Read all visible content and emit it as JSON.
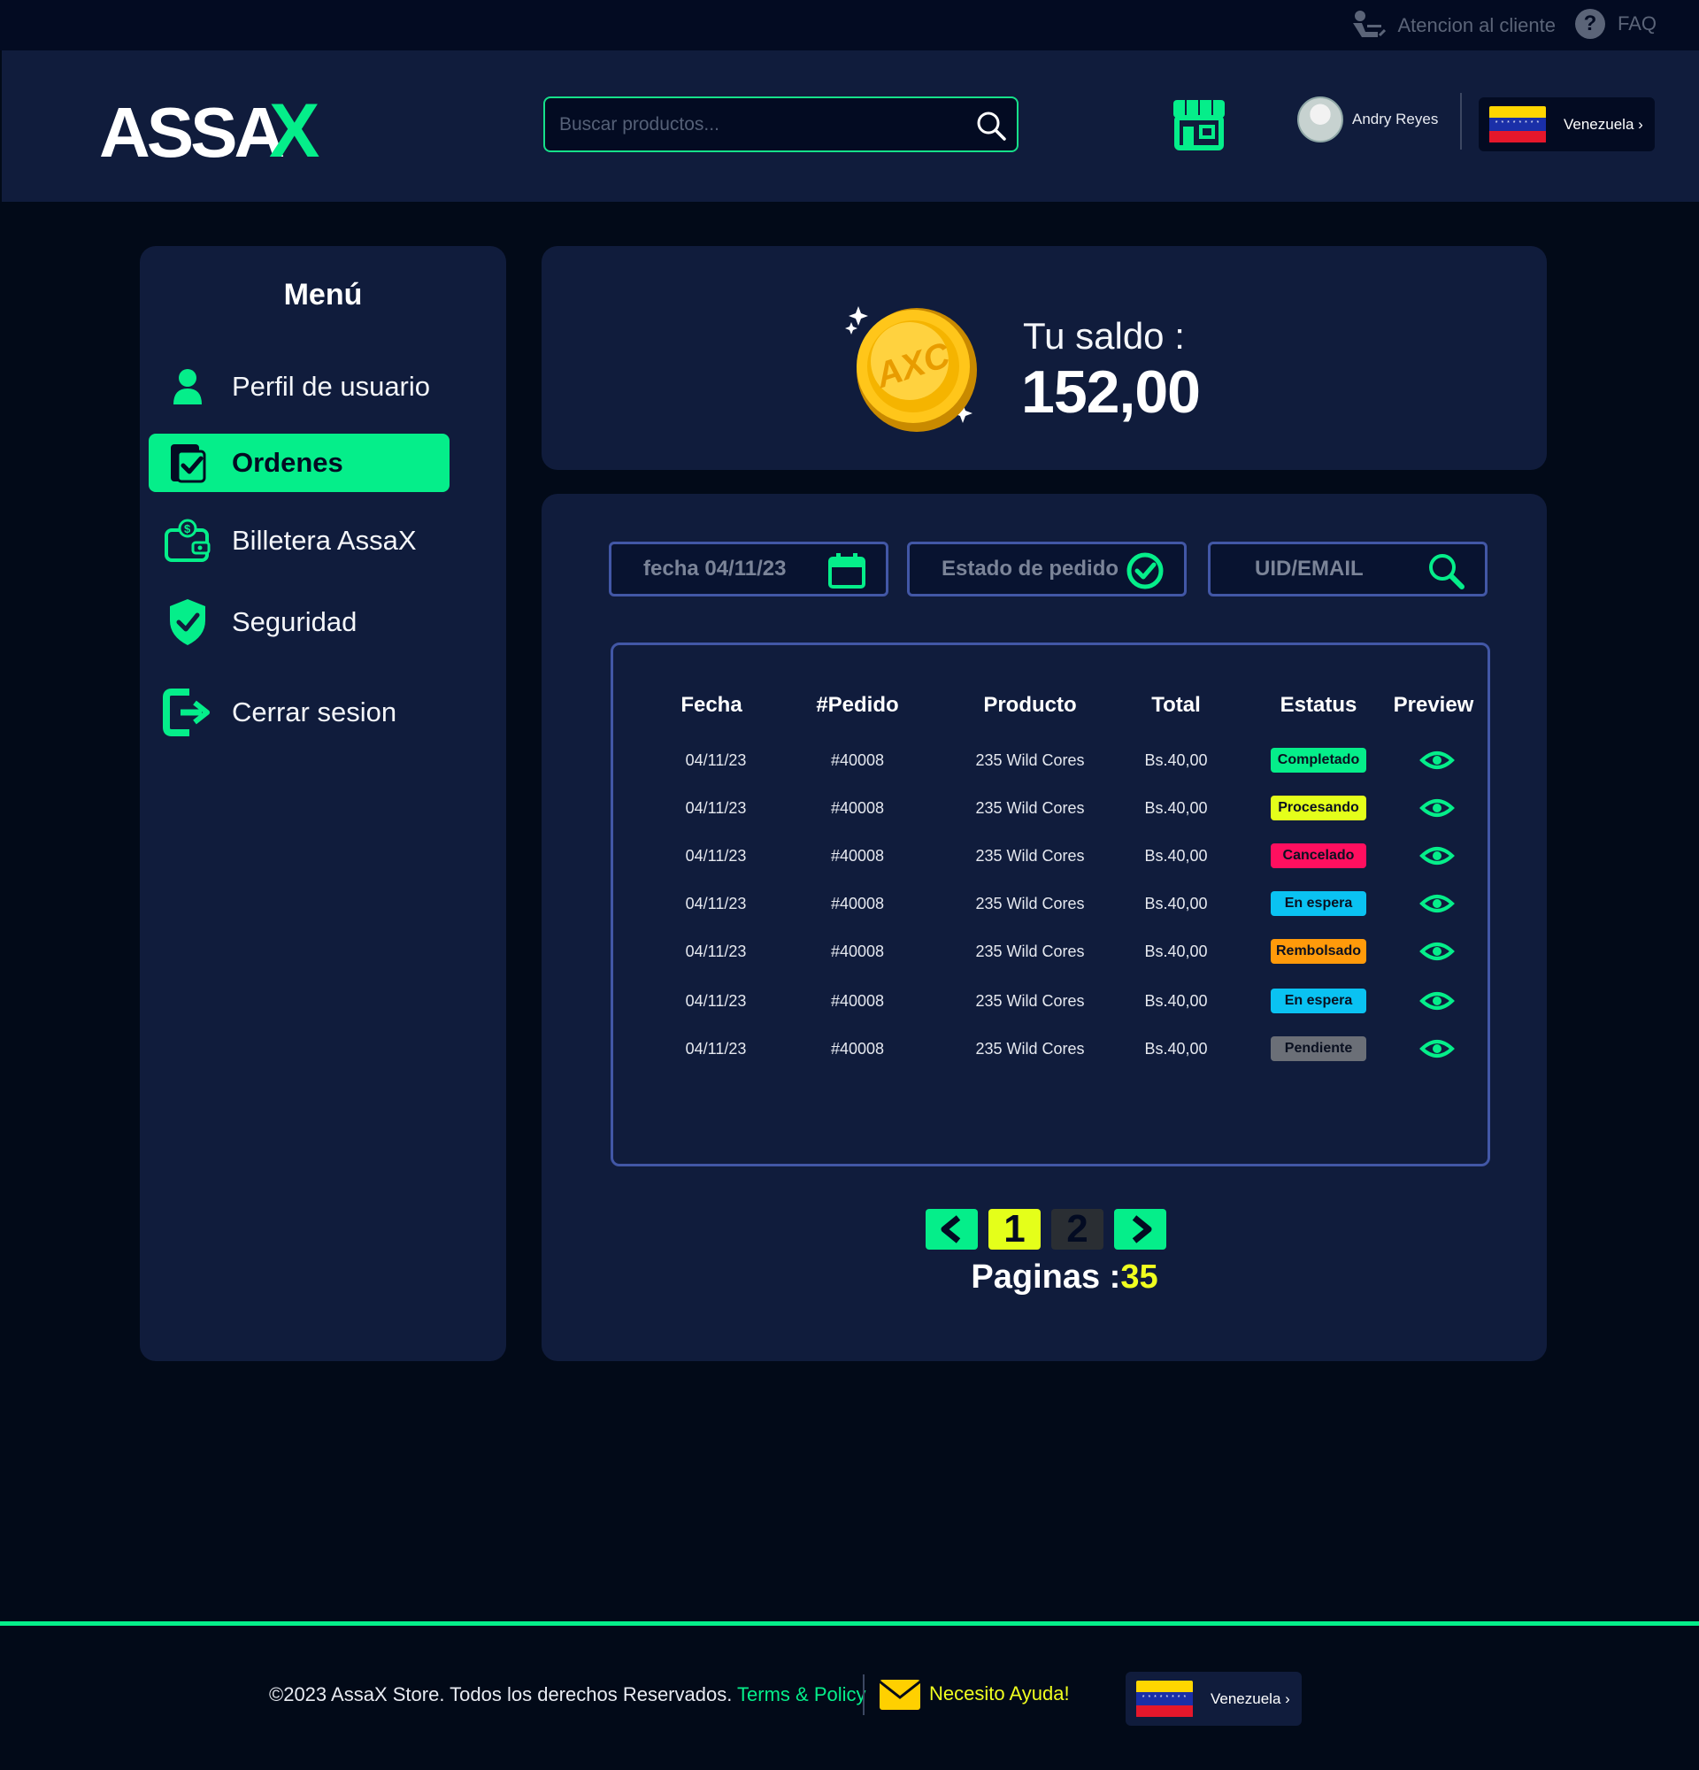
{
  "topbar": {
    "support_label": "Atencion al cliente",
    "faq_label": "FAQ"
  },
  "header": {
    "logo_text": "ASSAX",
    "search_placeholder": "Buscar productos...",
    "user_name": "Andry Reyes",
    "country": "Venezuela"
  },
  "sidebar": {
    "title": "Menú",
    "items": [
      {
        "label": "Perfil de usuario",
        "icon": "user-icon",
        "active": false
      },
      {
        "label": "Ordenes",
        "icon": "orders-check-icon",
        "active": true
      },
      {
        "label": "Billetera AssaX",
        "icon": "wallet-icon",
        "active": false
      },
      {
        "label": "Seguridad",
        "icon": "shield-check-icon",
        "active": false
      },
      {
        "label": "Cerrar sesion",
        "icon": "logout-icon",
        "active": false
      }
    ]
  },
  "balance": {
    "label": "Tu saldo :",
    "value": "152,00",
    "coin_text": "AXC"
  },
  "filters": {
    "date": "fecha 04/11/23",
    "status": "Estado de pedido",
    "uid": "UID/EMAIL"
  },
  "table": {
    "headers": [
      "Fecha",
      "#Pedido",
      "Producto",
      "Total",
      "Estatus",
      "Preview"
    ],
    "rows": [
      {
        "fecha": "04/11/23",
        "pedido": "#40008",
        "producto": "235 Wild Cores",
        "total": "Bs.40,00",
        "estatus": "Completado",
        "color": "#05ee8a"
      },
      {
        "fecha": "04/11/23",
        "pedido": "#40008",
        "producto": "235 Wild Cores",
        "total": "Bs.40,00",
        "estatus": "Procesando",
        "color": "#e4ff1a"
      },
      {
        "fecha": "04/11/23",
        "pedido": "#40008",
        "producto": "235 Wild Cores",
        "total": "Bs.40,00",
        "estatus": "Cancelado",
        "color": "#ff0f5f"
      },
      {
        "fecha": "04/11/23",
        "pedido": "#40008",
        "producto": "235 Wild Cores",
        "total": "Bs.40,00",
        "estatus": "En espera",
        "color": "#0ac2f2"
      },
      {
        "fecha": "04/11/23",
        "pedido": "#40008",
        "producto": "235 Wild Cores",
        "total": "Bs.40,00",
        "estatus": "Rembolsado",
        "color": "#ff9a0a"
      },
      {
        "fecha": "04/11/23",
        "pedido": "#40008",
        "producto": "235 Wild Cores",
        "total": "Bs.40,00",
        "estatus": "En espera",
        "color": "#0ac2f2"
      },
      {
        "fecha": "04/11/23",
        "pedido": "#40008",
        "producto": "235 Wild Cores",
        "total": "Bs.40,00",
        "estatus": "Pendiente",
        "color": "#6b6f77"
      }
    ]
  },
  "pagination": {
    "prev": "<",
    "pages": [
      "1",
      "2"
    ],
    "current": "1",
    "next": ">",
    "total_label": "Paginas :",
    "total": "35"
  },
  "footer": {
    "copyright": "©2023 AssaX Store. Todos los derechos Reservados.",
    "terms": "Terms & Policy",
    "help": "Necesito Ayuda!",
    "country": "Venezuela"
  },
  "colors": {
    "accent": "#05ee8a",
    "panel": "#101c3c",
    "background": "#020a18",
    "border": "#4257a6",
    "highlight": "#f0ff1f"
  }
}
